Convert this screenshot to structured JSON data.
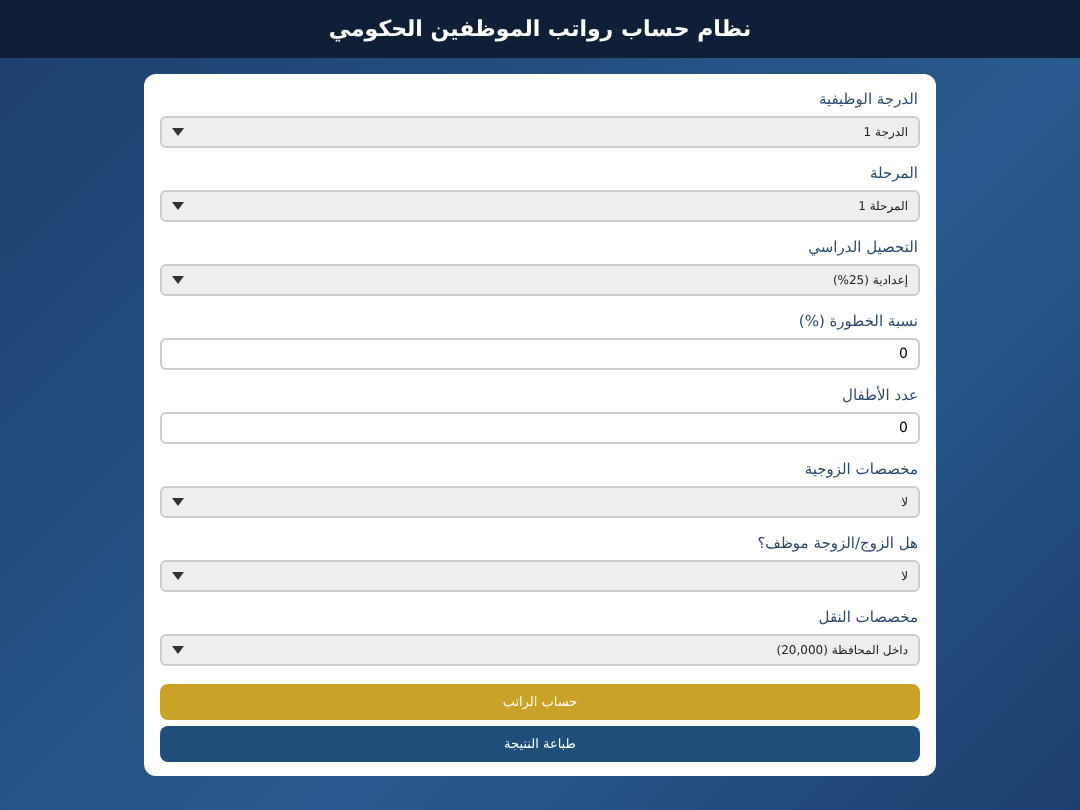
{
  "header": {
    "title": "نظام حساب رواتب الموظفين الحكومي"
  },
  "fields": [
    {
      "kind": "select",
      "label": "الدرجة الوظيفية",
      "value": "الدرجة 1"
    },
    {
      "kind": "select",
      "label": "المرحلة",
      "value": "المرحلة 1"
    },
    {
      "kind": "select",
      "label": "التحصيل الدراسي",
      "value": "إعدادية (25%)"
    },
    {
      "kind": "number",
      "label": "نسبة الخطورة (%)",
      "value": "0"
    },
    {
      "kind": "number",
      "label": "عدد الأطفال",
      "value": "0"
    },
    {
      "kind": "select",
      "label": "مخصصات الزوجية",
      "value": "لا"
    },
    {
      "kind": "select",
      "label": "هل الزوج/الزوجة موظف؟",
      "value": "لا"
    },
    {
      "kind": "select",
      "label": "مخصصات النقل",
      "value": "داخل المحافظة (20,000)"
    }
  ],
  "buttons": [
    {
      "kind": "primary",
      "label": "حساب الراتب"
    },
    {
      "kind": "secondary",
      "label": "طباعة النتيجة"
    }
  ]
}
